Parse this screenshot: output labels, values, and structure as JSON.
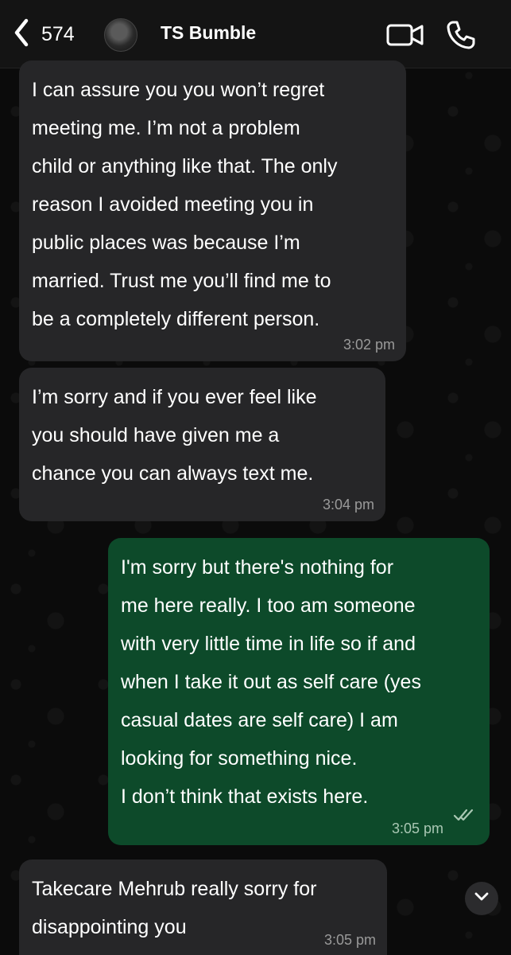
{
  "header": {
    "back_count": "574",
    "contact_name": "TS Bumble"
  },
  "messages": [
    {
      "direction": "incoming",
      "text": "I can assure you you won’t regret\nmeeting me. I’m not a problem\nchild or anything like that. The only\nreason I avoided meeting you in\npublic places was because I’m\nmarried. Trust me you’ll find me to\nbe a completely different person.",
      "time": "3:02 pm"
    },
    {
      "direction": "incoming",
      "text": "I’m sorry and if you ever feel like\nyou should have given me a\nchance you can always text me.",
      "time": "3:04 pm"
    },
    {
      "direction": "outgoing",
      "text": "I'm sorry but there's nothing for\nme here really. I too am someone\nwith very little time in life so if and\nwhen I take it out as self care (yes\ncasual dates are self care) I am\nlooking for something nice.\nI don’t think that exists here.",
      "time": "3:05 pm",
      "status": "read"
    },
    {
      "direction": "incoming",
      "text": "Takecare Mehrub really sorry for\ndisappointing you",
      "time": "3:05 pm"
    }
  ],
  "icons": {
    "back": "chevron-left-icon",
    "video": "video-camera-icon",
    "phone": "phone-icon",
    "read_receipt": "double-check-icon",
    "scroll_down": "chevron-down-icon"
  },
  "colors": {
    "incoming_bubble": "#262628",
    "outgoing_bubble": "#0d4a2a",
    "background": "#0b0b0b",
    "read_tick": "#a9c7b3"
  }
}
